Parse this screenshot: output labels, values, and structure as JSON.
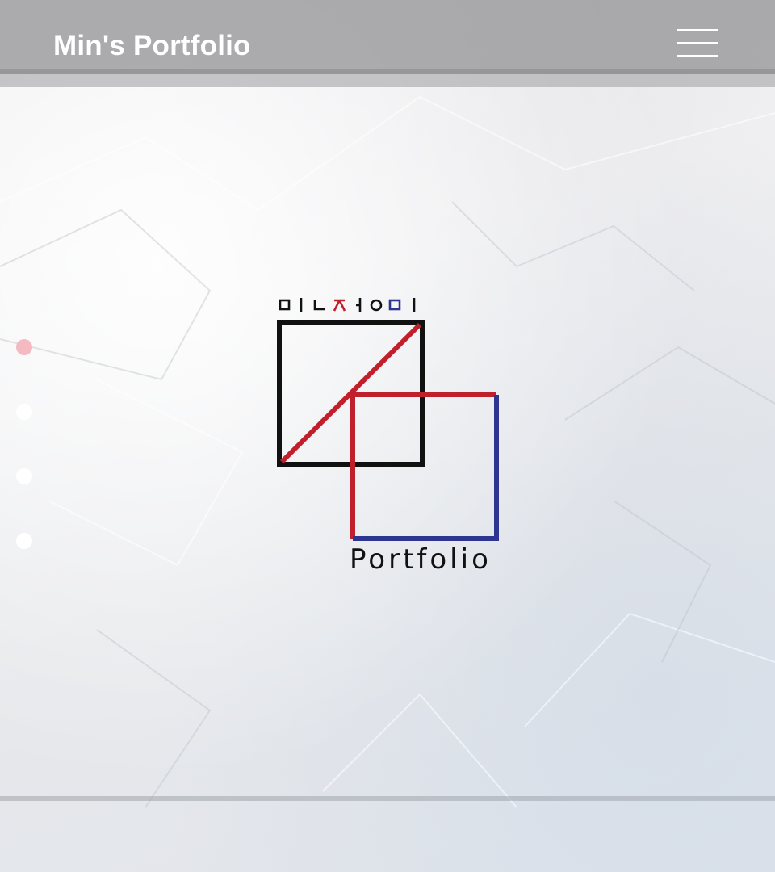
{
  "header": {
    "title": "Min's Portfolio",
    "menu_icon": "hamburger-icon"
  },
  "page_dots": [
    {
      "state": "active",
      "color": "#f5b9c2"
    },
    {
      "state": "inactive",
      "color": "#ffffff"
    },
    {
      "state": "inactive",
      "color": "#ffffff"
    },
    {
      "state": "inactive",
      "color": "#ffffff"
    }
  ],
  "logo": {
    "word": "Portfolio",
    "hangul_jamo": [
      "ㅁ",
      "ㅣ",
      "ㄴ",
      "ㅈ",
      "ㅓ",
      "ㅇ",
      "ㅁ",
      "ㅣ"
    ],
    "colors": {
      "black": "#111111",
      "red": "#c0202b",
      "blue": "#2d3590"
    }
  },
  "colors": {
    "header_bg": "#969698",
    "title_text": "#ffffff"
  }
}
